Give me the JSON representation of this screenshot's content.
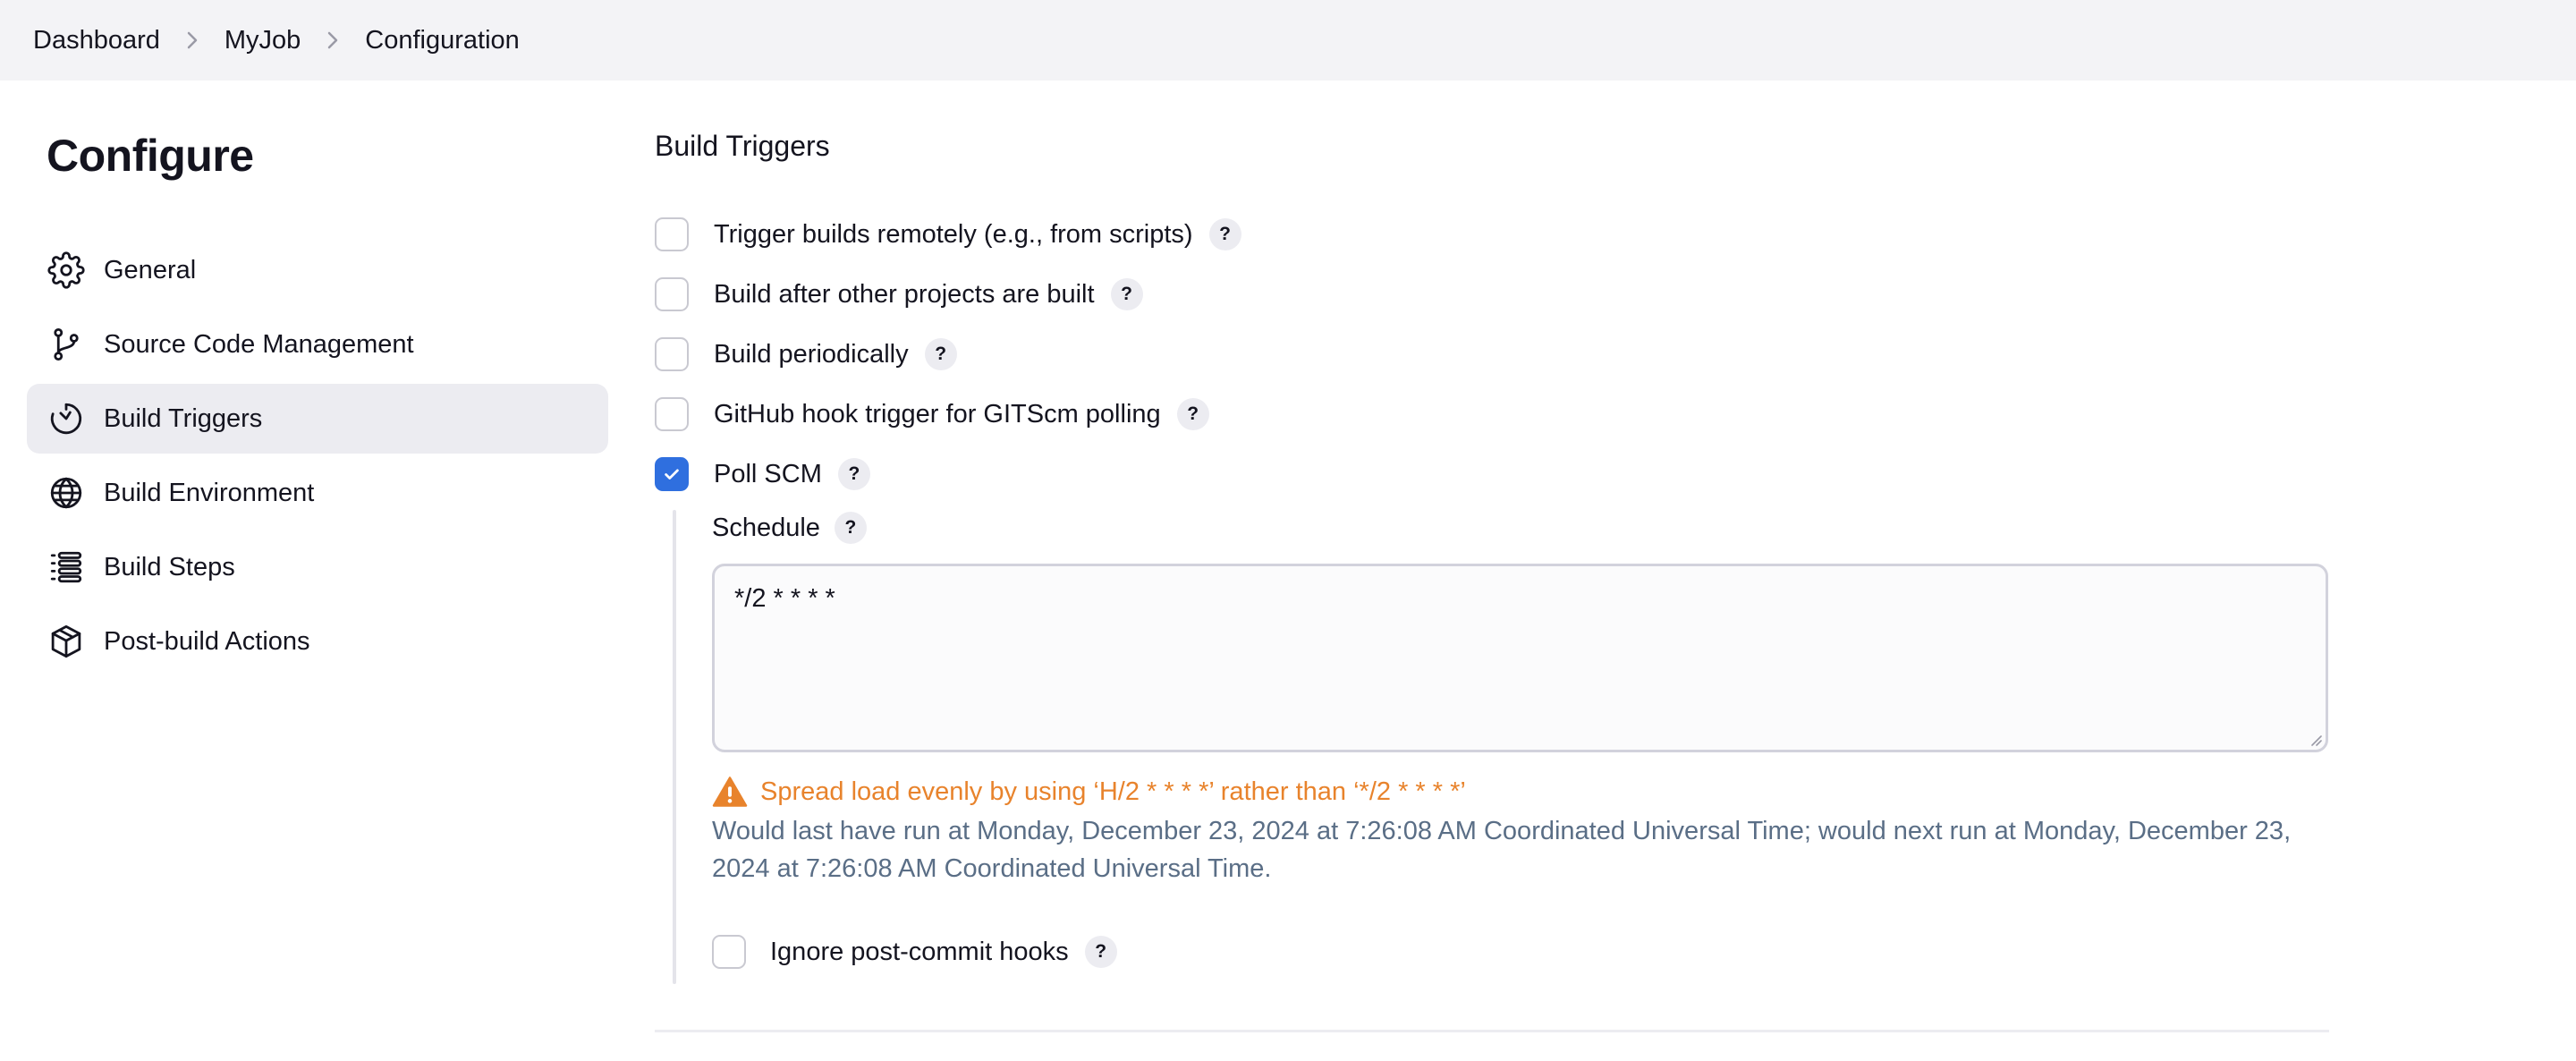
{
  "breadcrumb": {
    "items": [
      "Dashboard",
      "MyJob",
      "Configuration"
    ]
  },
  "page": {
    "title": "Configure"
  },
  "sidebar": {
    "items": [
      {
        "label": "General",
        "icon": "gear-icon"
      },
      {
        "label": "Source Code Management",
        "icon": "git-branch-icon"
      },
      {
        "label": "Build Triggers",
        "icon": "timer-icon",
        "active": true
      },
      {
        "label": "Build Environment",
        "icon": "globe-icon"
      },
      {
        "label": "Build Steps",
        "icon": "list-icon"
      },
      {
        "label": "Post-build Actions",
        "icon": "package-icon"
      }
    ]
  },
  "build_triggers": {
    "title": "Build Triggers",
    "options": [
      {
        "label": "Trigger builds remotely (e.g., from scripts)",
        "checked": false
      },
      {
        "label": "Build after other projects are built",
        "checked": false
      },
      {
        "label": "Build periodically",
        "checked": false
      },
      {
        "label": "GitHub hook trigger for GITScm polling",
        "checked": false
      },
      {
        "label": "Poll SCM",
        "checked": true
      }
    ],
    "help_glyph": "?",
    "poll_scm": {
      "schedule_label": "Schedule",
      "schedule_value": "*/2 * * * *",
      "warning": "Spread load evenly by using ‘H/2 * * * *’ rather than ‘*/2 * * * *’",
      "info": "Would last have run at Monday, December 23, 2024 at 7:26:08 AM Coordinated Universal Time; would next run at Monday, December 23, 2024 at 7:26:08 AM Coordinated Universal Time.",
      "ignore_hooks_label": "Ignore post-commit hooks",
      "ignore_hooks_checked": false
    }
  },
  "colors": {
    "accent": "#2f6fdf",
    "warning": "#e8832c",
    "info_text": "#5a6e86",
    "active_nav_bg": "#ececf1",
    "topbar_bg": "#f3f3f6"
  }
}
